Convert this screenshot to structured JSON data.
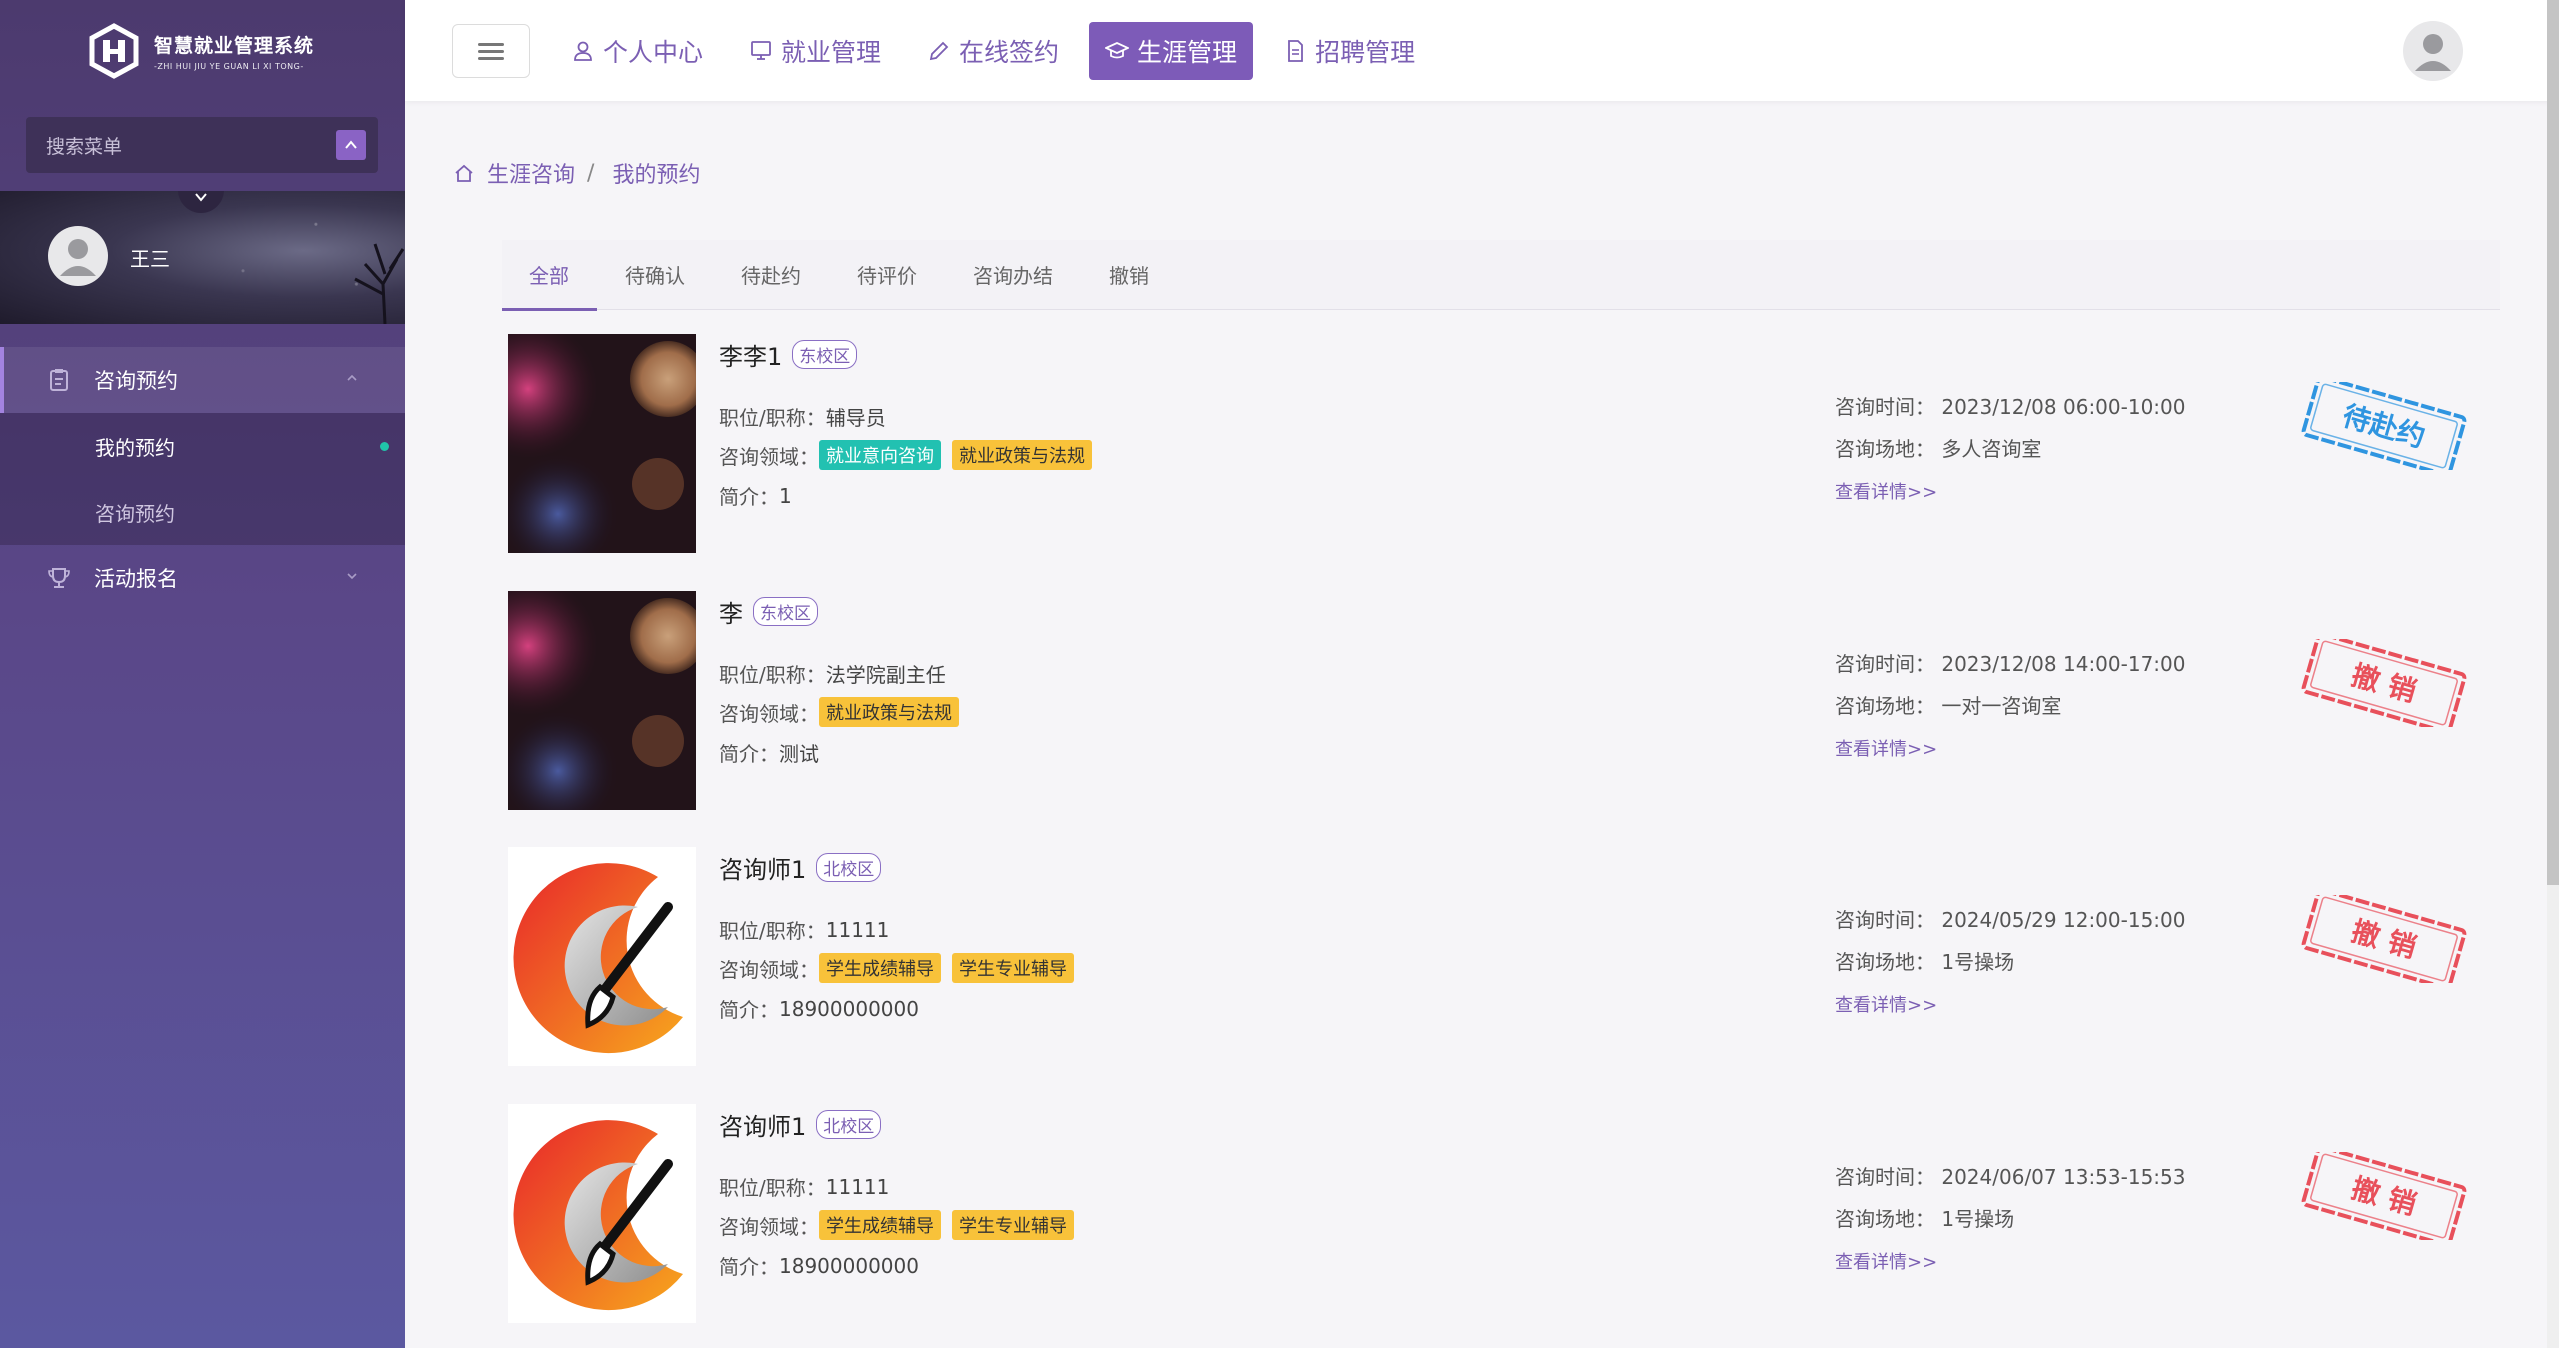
{
  "app": {
    "title": "智慧就业管理系统",
    "subtitle": "-ZHI HUI JIU YE GUAN LI XI TONG-"
  },
  "sidebar": {
    "search_placeholder": "搜索菜单",
    "user_name": "王三",
    "groups": [
      {
        "label": "咨询预约",
        "icon": "clipboard-icon",
        "expanded": true,
        "items": [
          {
            "label": "我的预约",
            "current": true
          },
          {
            "label": "咨询预约",
            "current": false
          }
        ]
      },
      {
        "label": "活动报名",
        "icon": "trophy-icon",
        "expanded": false,
        "items": []
      }
    ]
  },
  "topnav": [
    {
      "label": "个人中心",
      "icon": "user-icon",
      "active": false
    },
    {
      "label": "就业管理",
      "icon": "computer-icon",
      "active": false
    },
    {
      "label": "在线签约",
      "icon": "pencil-icon",
      "active": false
    },
    {
      "label": "生涯管理",
      "icon": "graduation-cap-icon",
      "active": true
    },
    {
      "label": "招聘管理",
      "icon": "document-icon",
      "active": false
    }
  ],
  "breadcrumb": [
    "生涯咨询",
    "我的预约"
  ],
  "tabs": [
    "全部",
    "待确认",
    "待赴约",
    "待评价",
    "咨询办结",
    "撤销"
  ],
  "labels": {
    "position": "职位/职称：",
    "field": "咨询领域：",
    "intro": "简介：",
    "time": "咨询时间：",
    "place": "咨询场地：",
    "detail_link": "查看详情>>"
  },
  "stamps": {
    "pending": "待赴约",
    "cancelled": "撤 销"
  },
  "colors": {
    "primary": "#7b5fb3",
    "sidebar": "#4c3a6e",
    "tag_teal": "#22c1b1",
    "tag_yellow": "#f8c23a",
    "stamp_blue": "#2f95e0",
    "stamp_red": "#e8505b"
  },
  "appointments": [
    {
      "name": "李李1",
      "campus": "东校区",
      "position": "辅导员",
      "tags": [
        {
          "text": "就业意向咨询",
          "color": "teal"
        },
        {
          "text": "就业政策与法规",
          "color": "yellow"
        }
      ],
      "intro": "1",
      "time": "2023/12/08 06:00-10:00",
      "place": "多人咨询室",
      "status": "pending",
      "photo": "bokeh-photo"
    },
    {
      "name": "李",
      "campus": "东校区",
      "position": "法学院副主任",
      "tags": [
        {
          "text": "就业政策与法规",
          "color": "yellow"
        }
      ],
      "intro": "测试",
      "time": "2023/12/08 14:00-17:00",
      "place": "一对一咨询室",
      "status": "cancelled",
      "photo": "bokeh-photo"
    },
    {
      "name": "咨询师1",
      "campus": "北校区",
      "position": "11111",
      "tags": [
        {
          "text": "学生成绩辅导",
          "color": "yellow"
        },
        {
          "text": "学生专业辅导",
          "color": "yellow"
        }
      ],
      "intro": "18900000000",
      "time": "2024/05/29 12:00-15:00",
      "place": "1号操场",
      "status": "cancelled",
      "photo": "brush-logo"
    },
    {
      "name": "咨询师1",
      "campus": "北校区",
      "position": "11111",
      "tags": [
        {
          "text": "学生成绩辅导",
          "color": "yellow"
        },
        {
          "text": "学生专业辅导",
          "color": "yellow"
        }
      ],
      "intro": "18900000000",
      "time": "2024/06/07 13:53-15:53",
      "place": "1号操场",
      "status": "cancelled",
      "photo": "brush-logo"
    }
  ]
}
